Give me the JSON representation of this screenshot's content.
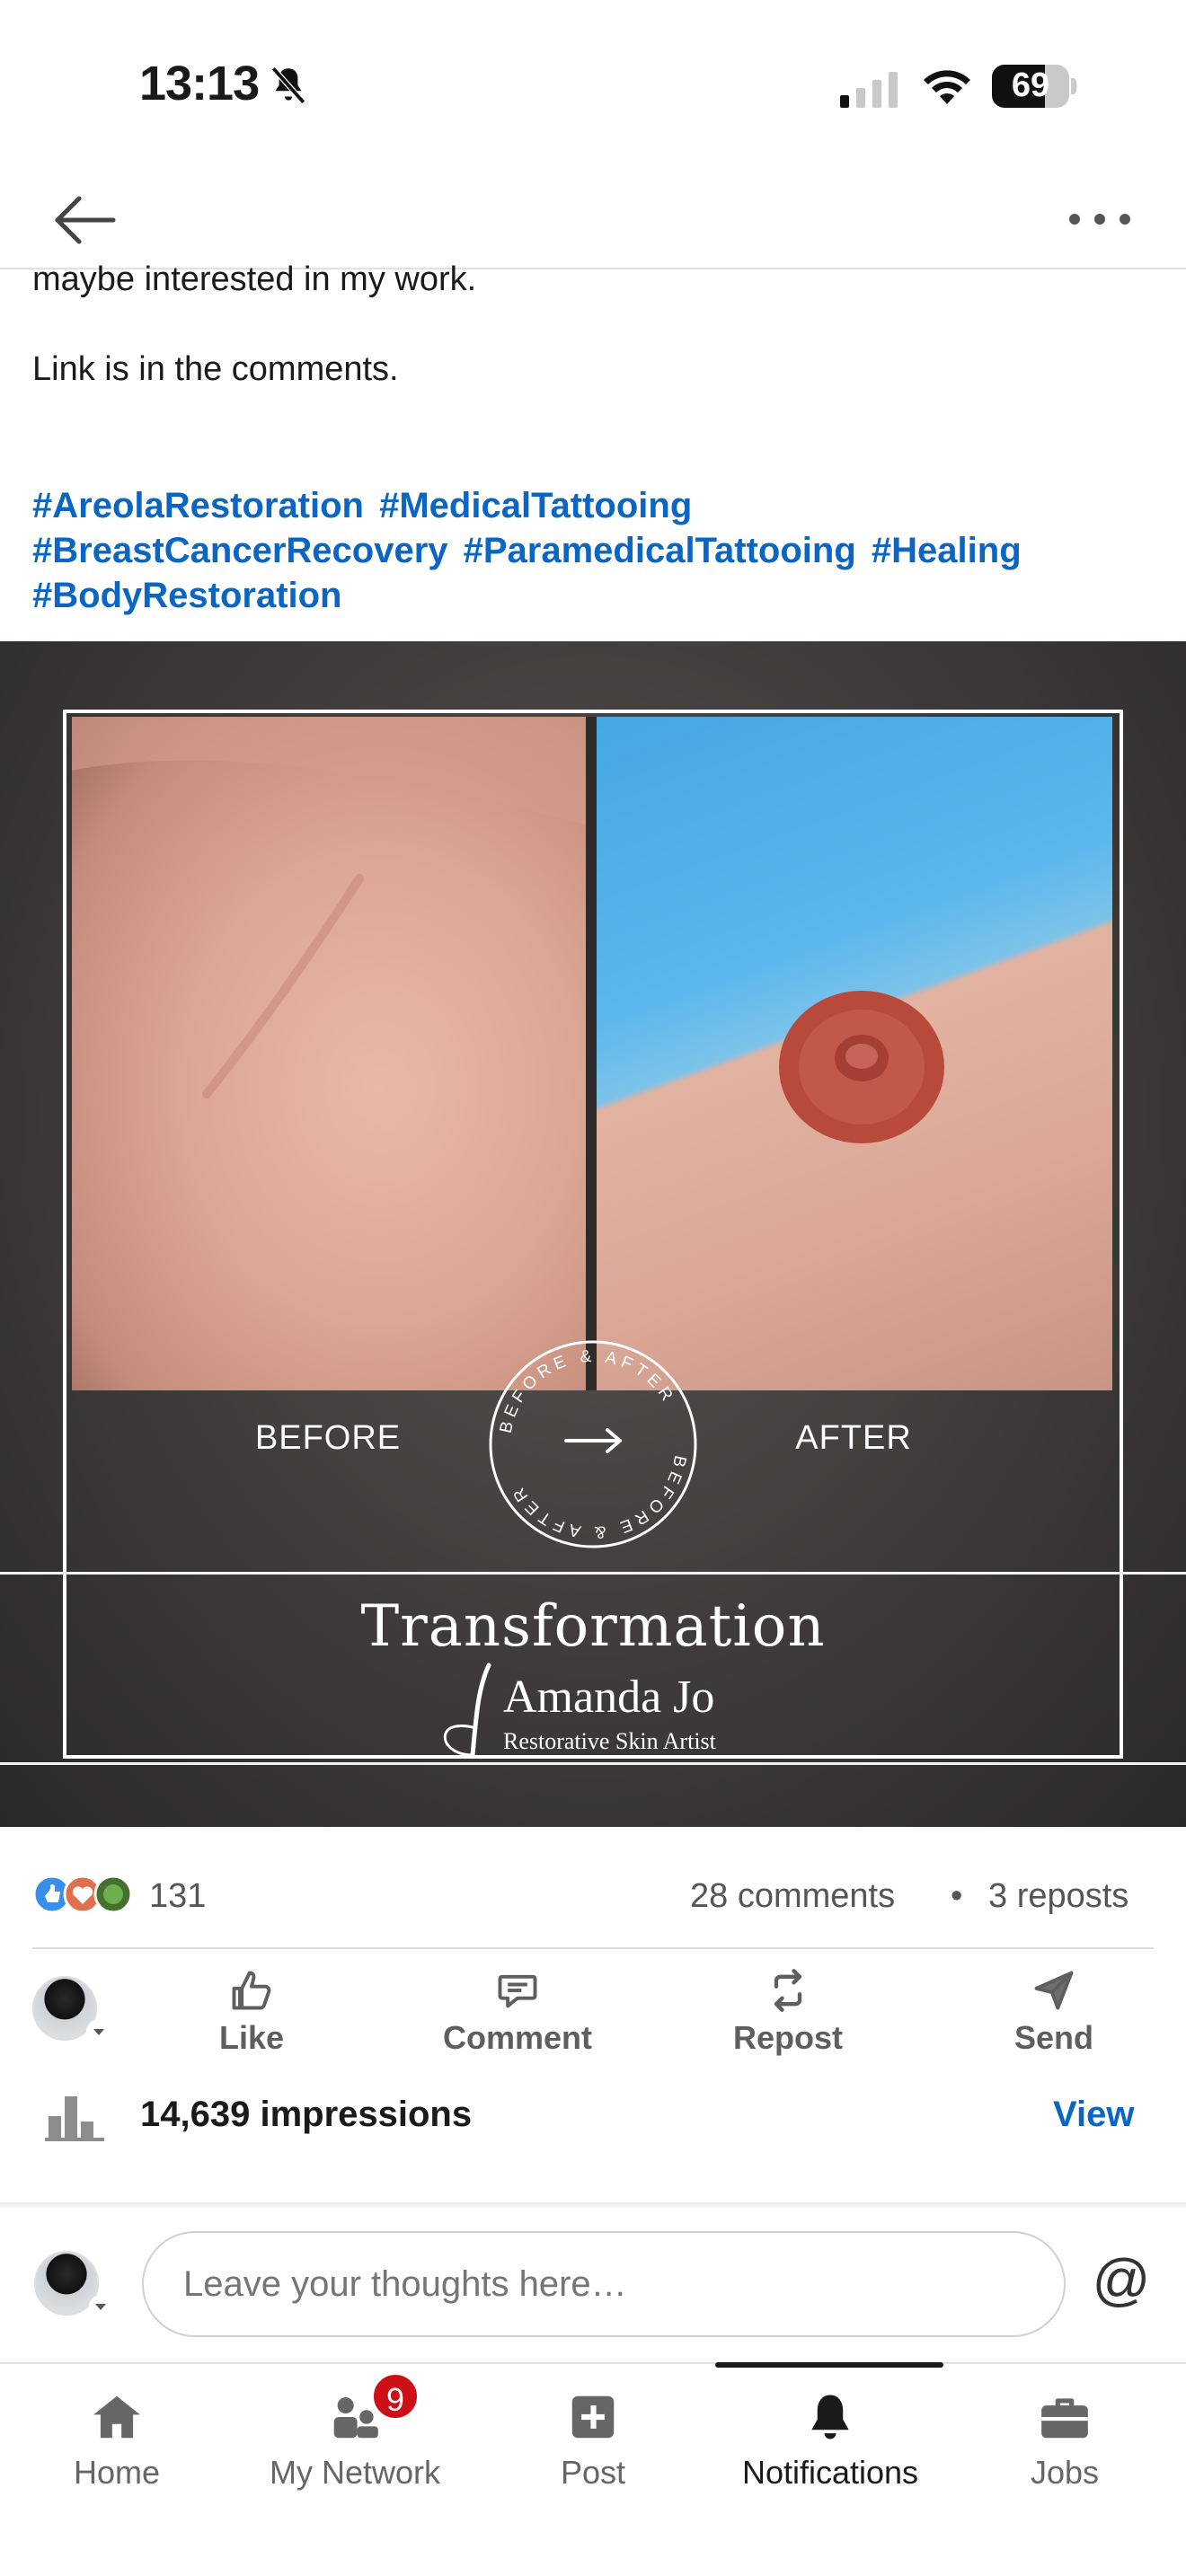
{
  "status_bar": {
    "time": "13:13",
    "battery_level": "69"
  },
  "post": {
    "text_line_1": "maybe interested in my work.",
    "text_line_2": "Link is in the comments.",
    "hashtags": [
      "#AreolaRestoration",
      "#MedicalTattooing",
      "#BreastCancerRecovery",
      "#ParamedicalTattooing",
      "#Healing",
      "#BodyRestoration"
    ],
    "image": {
      "label_before": "BEFORE",
      "label_after": "AFTER",
      "badge_text": "BEFORE & AFTER",
      "title": "Transformation",
      "brand_name": "Amanda Jo",
      "brand_tagline": "Restorative Skin Artist"
    }
  },
  "social": {
    "reaction_count": "131",
    "comments": "28 comments",
    "separator": "•",
    "reposts": "3 reposts"
  },
  "actions": {
    "like": "Like",
    "comment": "Comment",
    "repost": "Repost",
    "send": "Send"
  },
  "impressions": {
    "text": "14,639 impressions",
    "view_label": "View"
  },
  "composer": {
    "placeholder": "Leave your thoughts here…",
    "at_symbol": "@"
  },
  "bottom_nav": {
    "home": "Home",
    "network": "My Network",
    "network_badge": "9",
    "post": "Post",
    "notifications": "Notifications",
    "jobs": "Jobs",
    "active": "notifications"
  },
  "colors": {
    "link_blue": "#0a66c2",
    "badge_red": "#cc1016",
    "text_primary": "#1a1a1a",
    "text_secondary": "#5e5e5e"
  }
}
